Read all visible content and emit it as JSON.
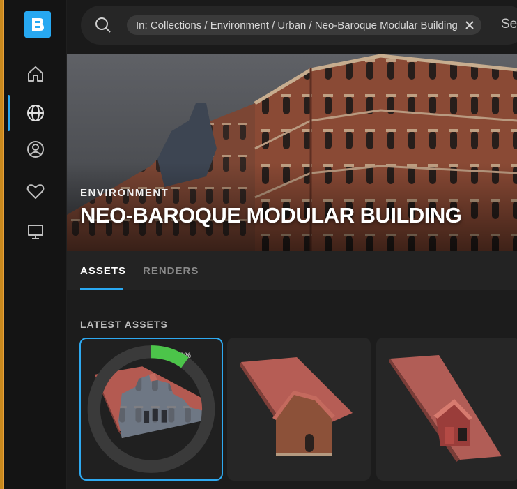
{
  "app": {
    "logo_letter": "B"
  },
  "sidebar": {
    "items": [
      {
        "name": "home",
        "icon": "home-icon"
      },
      {
        "name": "browse",
        "icon": "globe-icon",
        "active": true
      },
      {
        "name": "profile",
        "icon": "user-circle-icon"
      },
      {
        "name": "favorites",
        "icon": "heart-icon"
      },
      {
        "name": "desktop",
        "icon": "monitor-icon"
      }
    ]
  },
  "search": {
    "filter_chip": "In: Collections / Environment / Urban / Neo-Baroque Modular Building",
    "placeholder": "Se"
  },
  "hero": {
    "category": "ENVIRONMENT",
    "title": "NEO-BAROQUE MODULAR BUILDING"
  },
  "tabs": [
    {
      "label": "ASSETS",
      "active": true
    },
    {
      "label": "RENDERS",
      "active": false
    }
  ],
  "assets": {
    "section_title": "LATEST ASSETS",
    "cards": [
      {
        "name": "stepped-gable-roof",
        "selected": true,
        "progress": "9%"
      },
      {
        "name": "roof-with-brick-gable",
        "selected": false
      },
      {
        "name": "roof-with-dormer",
        "selected": false
      }
    ]
  },
  "colors": {
    "accent": "#2aa9f2",
    "logo_bg": "#27a8f1",
    "sidebar_bg": "#141414"
  }
}
